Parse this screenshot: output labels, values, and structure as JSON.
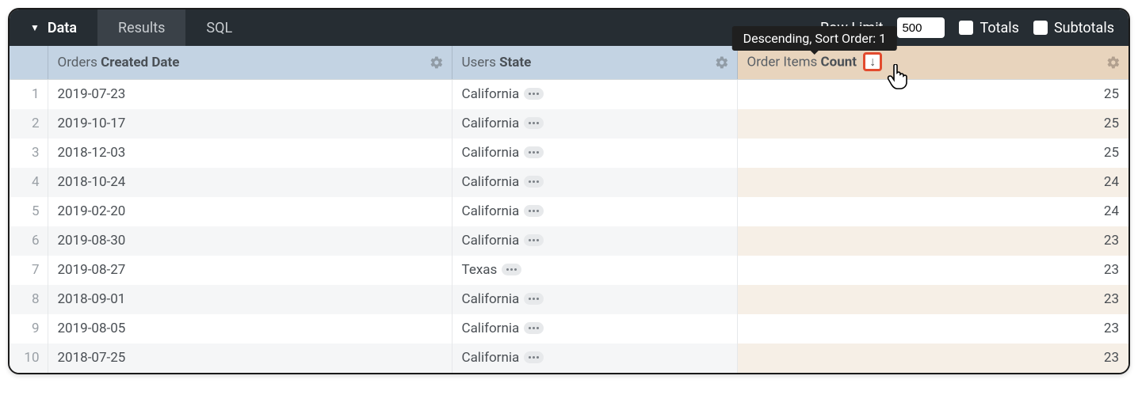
{
  "topbar": {
    "tabs": {
      "data": "Data",
      "results": "Results",
      "sql": "SQL"
    },
    "row_limit_label": "Row Limit",
    "row_limit_value": "500",
    "totals_label": "Totals",
    "subtotals_label": "Subtotals"
  },
  "tooltip": "Descending, Sort Order: 1",
  "columns": {
    "orders_date_prefix": "Orders ",
    "orders_date_bold": "Created Date",
    "users_state_prefix": "Users ",
    "users_state_bold": "State",
    "order_items_prefix": "Order Items ",
    "order_items_bold": "Count"
  },
  "rows": [
    {
      "n": "1",
      "date": "2019-07-23",
      "state": "California",
      "count": "25"
    },
    {
      "n": "2",
      "date": "2019-10-17",
      "state": "California",
      "count": "25"
    },
    {
      "n": "3",
      "date": "2018-12-03",
      "state": "California",
      "count": "25"
    },
    {
      "n": "4",
      "date": "2018-10-24",
      "state": "California",
      "count": "24"
    },
    {
      "n": "5",
      "date": "2019-02-20",
      "state": "California",
      "count": "24"
    },
    {
      "n": "6",
      "date": "2019-08-30",
      "state": "California",
      "count": "23"
    },
    {
      "n": "7",
      "date": "2019-08-27",
      "state": "Texas",
      "count": "23"
    },
    {
      "n": "8",
      "date": "2018-09-01",
      "state": "California",
      "count": "23"
    },
    {
      "n": "9",
      "date": "2019-08-05",
      "state": "California",
      "count": "23"
    },
    {
      "n": "10",
      "date": "2018-07-25",
      "state": "California",
      "count": "23"
    }
  ]
}
